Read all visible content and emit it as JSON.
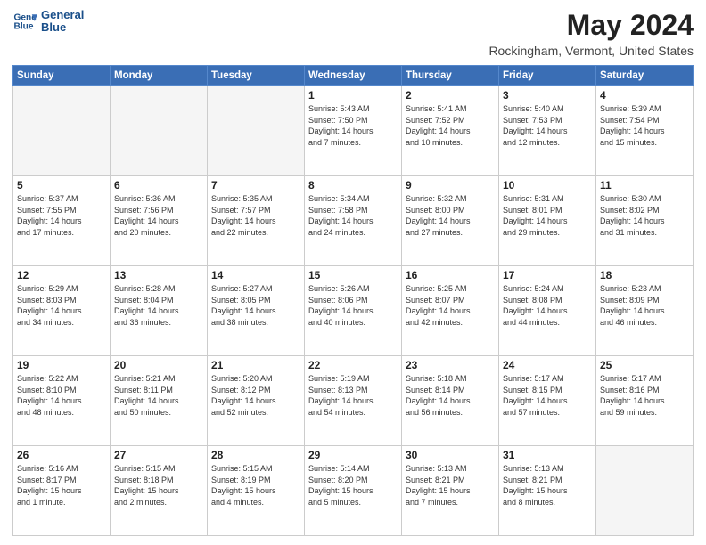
{
  "header": {
    "logo_line1": "General",
    "logo_line2": "Blue",
    "main_title": "May 2024",
    "subtitle": "Rockingham, Vermont, United States"
  },
  "days_of_week": [
    "Sunday",
    "Monday",
    "Tuesday",
    "Wednesday",
    "Thursday",
    "Friday",
    "Saturday"
  ],
  "weeks": [
    [
      {
        "day": "",
        "empty": true
      },
      {
        "day": "",
        "empty": true
      },
      {
        "day": "",
        "empty": true
      },
      {
        "day": "1",
        "info": "Sunrise: 5:43 AM\nSunset: 7:50 PM\nDaylight: 14 hours\nand 7 minutes."
      },
      {
        "day": "2",
        "info": "Sunrise: 5:41 AM\nSunset: 7:52 PM\nDaylight: 14 hours\nand 10 minutes."
      },
      {
        "day": "3",
        "info": "Sunrise: 5:40 AM\nSunset: 7:53 PM\nDaylight: 14 hours\nand 12 minutes."
      },
      {
        "day": "4",
        "info": "Sunrise: 5:39 AM\nSunset: 7:54 PM\nDaylight: 14 hours\nand 15 minutes."
      }
    ],
    [
      {
        "day": "5",
        "info": "Sunrise: 5:37 AM\nSunset: 7:55 PM\nDaylight: 14 hours\nand 17 minutes."
      },
      {
        "day": "6",
        "info": "Sunrise: 5:36 AM\nSunset: 7:56 PM\nDaylight: 14 hours\nand 20 minutes."
      },
      {
        "day": "7",
        "info": "Sunrise: 5:35 AM\nSunset: 7:57 PM\nDaylight: 14 hours\nand 22 minutes."
      },
      {
        "day": "8",
        "info": "Sunrise: 5:34 AM\nSunset: 7:58 PM\nDaylight: 14 hours\nand 24 minutes."
      },
      {
        "day": "9",
        "info": "Sunrise: 5:32 AM\nSunset: 8:00 PM\nDaylight: 14 hours\nand 27 minutes."
      },
      {
        "day": "10",
        "info": "Sunrise: 5:31 AM\nSunset: 8:01 PM\nDaylight: 14 hours\nand 29 minutes."
      },
      {
        "day": "11",
        "info": "Sunrise: 5:30 AM\nSunset: 8:02 PM\nDaylight: 14 hours\nand 31 minutes."
      }
    ],
    [
      {
        "day": "12",
        "info": "Sunrise: 5:29 AM\nSunset: 8:03 PM\nDaylight: 14 hours\nand 34 minutes."
      },
      {
        "day": "13",
        "info": "Sunrise: 5:28 AM\nSunset: 8:04 PM\nDaylight: 14 hours\nand 36 minutes."
      },
      {
        "day": "14",
        "info": "Sunrise: 5:27 AM\nSunset: 8:05 PM\nDaylight: 14 hours\nand 38 minutes."
      },
      {
        "day": "15",
        "info": "Sunrise: 5:26 AM\nSunset: 8:06 PM\nDaylight: 14 hours\nand 40 minutes."
      },
      {
        "day": "16",
        "info": "Sunrise: 5:25 AM\nSunset: 8:07 PM\nDaylight: 14 hours\nand 42 minutes."
      },
      {
        "day": "17",
        "info": "Sunrise: 5:24 AM\nSunset: 8:08 PM\nDaylight: 14 hours\nand 44 minutes."
      },
      {
        "day": "18",
        "info": "Sunrise: 5:23 AM\nSunset: 8:09 PM\nDaylight: 14 hours\nand 46 minutes."
      }
    ],
    [
      {
        "day": "19",
        "info": "Sunrise: 5:22 AM\nSunset: 8:10 PM\nDaylight: 14 hours\nand 48 minutes."
      },
      {
        "day": "20",
        "info": "Sunrise: 5:21 AM\nSunset: 8:11 PM\nDaylight: 14 hours\nand 50 minutes."
      },
      {
        "day": "21",
        "info": "Sunrise: 5:20 AM\nSunset: 8:12 PM\nDaylight: 14 hours\nand 52 minutes."
      },
      {
        "day": "22",
        "info": "Sunrise: 5:19 AM\nSunset: 8:13 PM\nDaylight: 14 hours\nand 54 minutes."
      },
      {
        "day": "23",
        "info": "Sunrise: 5:18 AM\nSunset: 8:14 PM\nDaylight: 14 hours\nand 56 minutes."
      },
      {
        "day": "24",
        "info": "Sunrise: 5:17 AM\nSunset: 8:15 PM\nDaylight: 14 hours\nand 57 minutes."
      },
      {
        "day": "25",
        "info": "Sunrise: 5:17 AM\nSunset: 8:16 PM\nDaylight: 14 hours\nand 59 minutes."
      }
    ],
    [
      {
        "day": "26",
        "info": "Sunrise: 5:16 AM\nSunset: 8:17 PM\nDaylight: 15 hours\nand 1 minute."
      },
      {
        "day": "27",
        "info": "Sunrise: 5:15 AM\nSunset: 8:18 PM\nDaylight: 15 hours\nand 2 minutes."
      },
      {
        "day": "28",
        "info": "Sunrise: 5:15 AM\nSunset: 8:19 PM\nDaylight: 15 hours\nand 4 minutes."
      },
      {
        "day": "29",
        "info": "Sunrise: 5:14 AM\nSunset: 8:20 PM\nDaylight: 15 hours\nand 5 minutes."
      },
      {
        "day": "30",
        "info": "Sunrise: 5:13 AM\nSunset: 8:21 PM\nDaylight: 15 hours\nand 7 minutes."
      },
      {
        "day": "31",
        "info": "Sunrise: 5:13 AM\nSunset: 8:21 PM\nDaylight: 15 hours\nand 8 minutes."
      },
      {
        "day": "",
        "empty": true
      }
    ]
  ]
}
